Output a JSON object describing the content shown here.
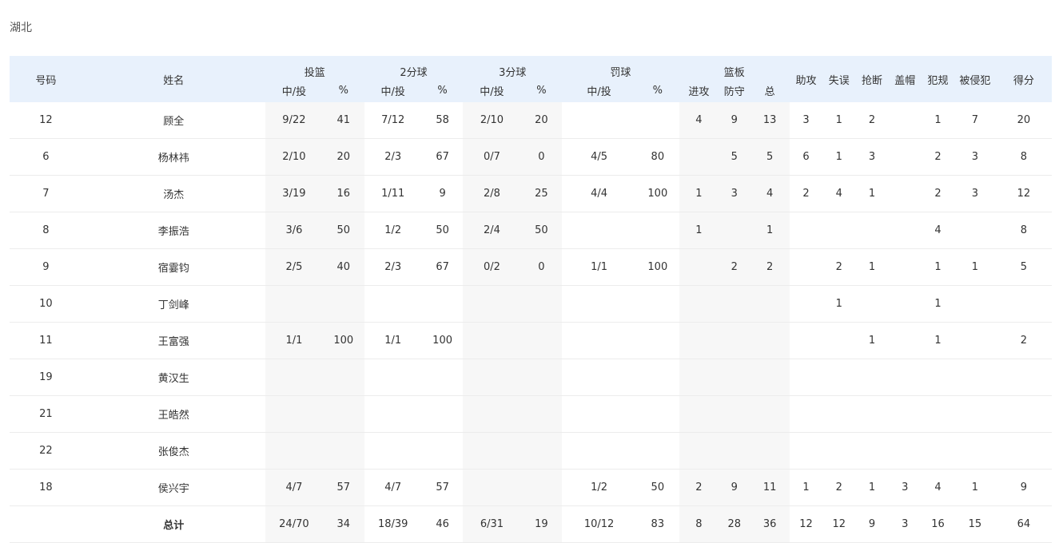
{
  "team": "湖北",
  "header": {
    "number": "号码",
    "name": "姓名",
    "groups": {
      "fg": "投篮",
      "two": "2分球",
      "three": "3分球",
      "ft": "罚球",
      "reb": "篮板"
    },
    "made_att": "中/投",
    "pct": "%",
    "reb_off": "进攻",
    "reb_def": "防守",
    "reb_tot": "总",
    "ast": "助攻",
    "tov": "失误",
    "stl": "抢断",
    "blk": "盖帽",
    "pf": "犯规",
    "fd": "被侵犯",
    "pts": "得分"
  },
  "rows": [
    {
      "num": "12",
      "name": "顾全",
      "fg": "9/22",
      "fg_pct": "41",
      "two": "7/12",
      "two_pct": "58",
      "three": "2/10",
      "three_pct": "20",
      "ft": "",
      "ft_pct": "",
      "oreb": "4",
      "dreb": "9",
      "treb": "13",
      "ast": "3",
      "tov": "1",
      "stl": "2",
      "blk": "",
      "pf": "1",
      "fd": "7",
      "pts": "20"
    },
    {
      "num": "6",
      "name": "杨林祎",
      "fg": "2/10",
      "fg_pct": "20",
      "two": "2/3",
      "two_pct": "67",
      "three": "0/7",
      "three_pct": "0",
      "ft": "4/5",
      "ft_pct": "80",
      "oreb": "",
      "dreb": "5",
      "treb": "5",
      "ast": "6",
      "tov": "1",
      "stl": "3",
      "blk": "",
      "pf": "2",
      "fd": "3",
      "pts": "8"
    },
    {
      "num": "7",
      "name": "汤杰",
      "fg": "3/19",
      "fg_pct": "16",
      "two": "1/11",
      "two_pct": "9",
      "three": "2/8",
      "three_pct": "25",
      "ft": "4/4",
      "ft_pct": "100",
      "oreb": "1",
      "dreb": "3",
      "treb": "4",
      "ast": "2",
      "tov": "4",
      "stl": "1",
      "blk": "",
      "pf": "2",
      "fd": "3",
      "pts": "12"
    },
    {
      "num": "8",
      "name": "李振浩",
      "fg": "3/6",
      "fg_pct": "50",
      "two": "1/2",
      "two_pct": "50",
      "three": "2/4",
      "three_pct": "50",
      "ft": "",
      "ft_pct": "",
      "oreb": "1",
      "dreb": "",
      "treb": "1",
      "ast": "",
      "tov": "",
      "stl": "",
      "blk": "",
      "pf": "4",
      "fd": "",
      "pts": "8"
    },
    {
      "num": "9",
      "name": "宿霎钧",
      "fg": "2/5",
      "fg_pct": "40",
      "two": "2/3",
      "two_pct": "67",
      "three": "0/2",
      "three_pct": "0",
      "ft": "1/1",
      "ft_pct": "100",
      "oreb": "",
      "dreb": "2",
      "treb": "2",
      "ast": "",
      "tov": "2",
      "stl": "1",
      "blk": "",
      "pf": "1",
      "fd": "1",
      "pts": "5"
    },
    {
      "num": "10",
      "name": "丁剑峰",
      "fg": "",
      "fg_pct": "",
      "two": "",
      "two_pct": "",
      "three": "",
      "three_pct": "",
      "ft": "",
      "ft_pct": "",
      "oreb": "",
      "dreb": "",
      "treb": "",
      "ast": "",
      "tov": "1",
      "stl": "",
      "blk": "",
      "pf": "1",
      "fd": "",
      "pts": ""
    },
    {
      "num": "11",
      "name": "王富强",
      "fg": "1/1",
      "fg_pct": "100",
      "two": "1/1",
      "two_pct": "100",
      "three": "",
      "three_pct": "",
      "ft": "",
      "ft_pct": "",
      "oreb": "",
      "dreb": "",
      "treb": "",
      "ast": "",
      "tov": "",
      "stl": "1",
      "blk": "",
      "pf": "1",
      "fd": "",
      "pts": "2"
    },
    {
      "num": "19",
      "name": "黄汉生",
      "fg": "",
      "fg_pct": "",
      "two": "",
      "two_pct": "",
      "three": "",
      "three_pct": "",
      "ft": "",
      "ft_pct": "",
      "oreb": "",
      "dreb": "",
      "treb": "",
      "ast": "",
      "tov": "",
      "stl": "",
      "blk": "",
      "pf": "",
      "fd": "",
      "pts": ""
    },
    {
      "num": "21",
      "name": "王皓然",
      "fg": "",
      "fg_pct": "",
      "two": "",
      "two_pct": "",
      "three": "",
      "three_pct": "",
      "ft": "",
      "ft_pct": "",
      "oreb": "",
      "dreb": "",
      "treb": "",
      "ast": "",
      "tov": "",
      "stl": "",
      "blk": "",
      "pf": "",
      "fd": "",
      "pts": ""
    },
    {
      "num": "22",
      "name": "张俊杰",
      "fg": "",
      "fg_pct": "",
      "two": "",
      "two_pct": "",
      "three": "",
      "three_pct": "",
      "ft": "",
      "ft_pct": "",
      "oreb": "",
      "dreb": "",
      "treb": "",
      "ast": "",
      "tov": "",
      "stl": "",
      "blk": "",
      "pf": "",
      "fd": "",
      "pts": ""
    },
    {
      "num": "18",
      "name": "侯兴宇",
      "fg": "4/7",
      "fg_pct": "57",
      "two": "4/7",
      "two_pct": "57",
      "three": "",
      "three_pct": "",
      "ft": "1/2",
      "ft_pct": "50",
      "oreb": "2",
      "dreb": "9",
      "treb": "11",
      "ast": "1",
      "tov": "2",
      "stl": "1",
      "blk": "3",
      "pf": "4",
      "fd": "1",
      "pts": "9"
    },
    {
      "num": "",
      "name": "总计",
      "fg": "24/70",
      "fg_pct": "34",
      "two": "18/39",
      "two_pct": "46",
      "three": "6/31",
      "three_pct": "19",
      "ft": "10/12",
      "ft_pct": "83",
      "oreb": "8",
      "dreb": "28",
      "treb": "36",
      "ast": "12",
      "tov": "12",
      "stl": "9",
      "blk": "3",
      "pf": "16",
      "fd": "15",
      "pts": "64"
    }
  ]
}
